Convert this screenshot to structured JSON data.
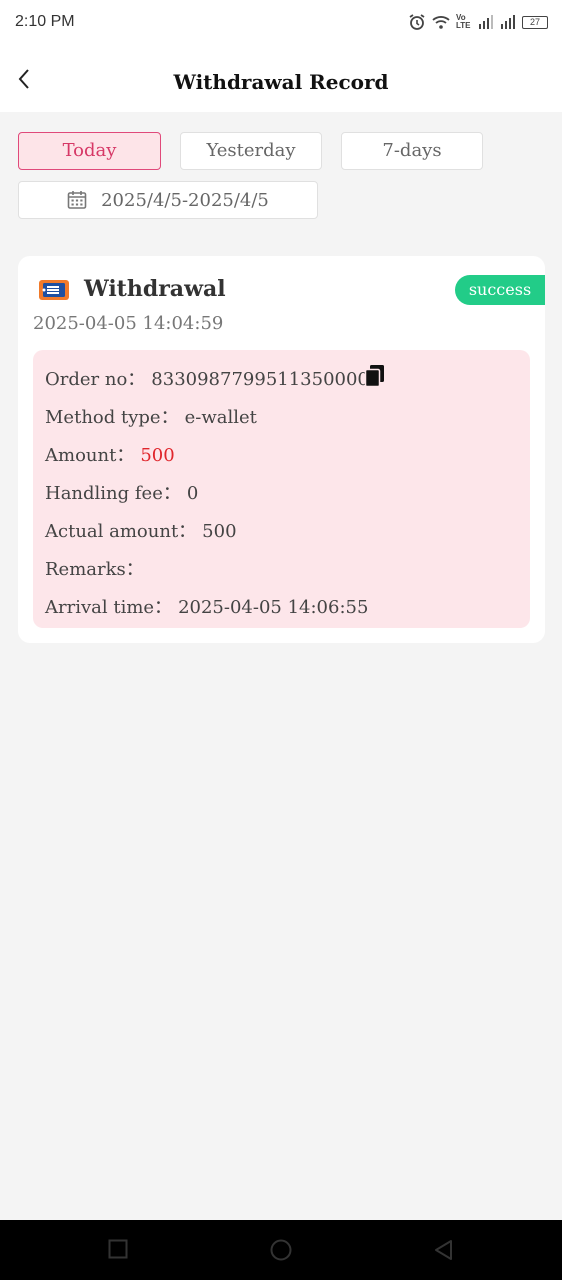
{
  "status_bar": {
    "time": "2:10 PM",
    "icons": [
      "alarm-icon",
      "wifi-icon",
      "volte-icon",
      "signal-icon",
      "signal-icon",
      "battery-icon"
    ],
    "volte_text": "Vo LTE",
    "battery": "27"
  },
  "header": {
    "title": "Withdrawal Record"
  },
  "filters": {
    "today": "Today",
    "yesterday": "Yesterday",
    "seven_days": "7-days",
    "active": "Today",
    "date_range": "2025/4/5-2025/4/5"
  },
  "record": {
    "title": "Withdrawal",
    "status": "success",
    "datetime": "2025-04-05 14:04:59",
    "order_no_label": "Order no：",
    "order_no": "83309877995113500001",
    "method_label": "Method type：",
    "method": "e-wallet",
    "amount_label": "Amount：",
    "amount": "500",
    "fee_label": "Handling fee：",
    "fee": "0",
    "actual_label": "Actual amount：",
    "actual": "500",
    "remarks_label": "Remarks：",
    "remarks": "",
    "arrival_label": "Arrival time：",
    "arrival": "2025-04-05 14:06:55"
  },
  "colors": {
    "accent": "#e0497a",
    "success": "#22cc88",
    "amount": "#e0262c",
    "details_bg": "#fde6ea"
  }
}
